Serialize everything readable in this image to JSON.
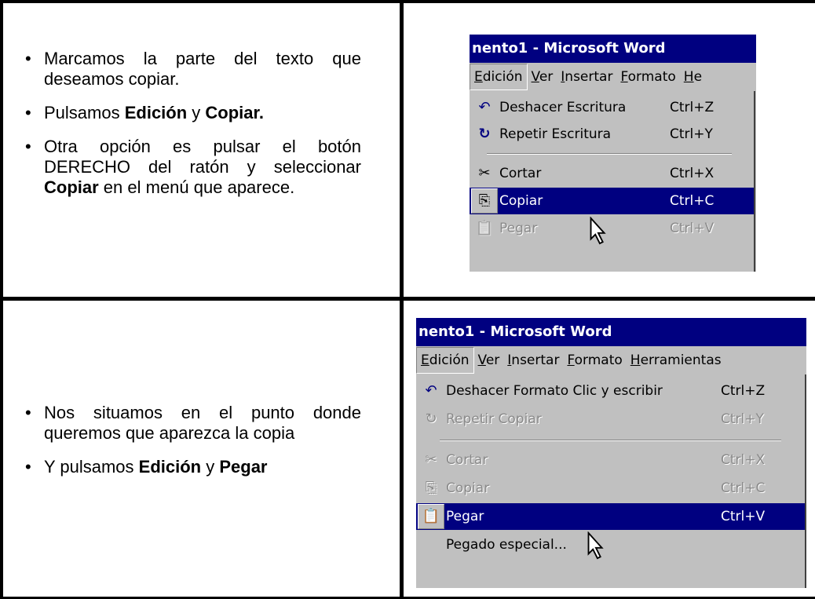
{
  "row1": {
    "bullets": [
      {
        "text": "Marcamos la parte del texto que deseamos copiar."
      },
      {
        "pre": "Pulsamos ",
        "b1": "Edición",
        "mid": " y ",
        "b2": "Copiar."
      },
      {
        "pre": "Otra opción es pulsar el botón DERECHO del ratón y seleccionar ",
        "b1": "Copiar",
        "post": " en el menú que aparece."
      }
    ],
    "screenshot": {
      "title": "nento1 - Microsoft Word",
      "menus": [
        "Edición",
        "Ver",
        "Insertar",
        "Formato",
        "He"
      ],
      "items": [
        {
          "icon": "↶",
          "label": "Deshacer Escritura",
          "shortcut": "Ctrl+Z"
        },
        {
          "icon": "↻",
          "label": "Repetir Escritura",
          "shortcut": "Ctrl+Y"
        },
        {
          "icon": "✂",
          "label": "Cortar",
          "shortcut": "Ctrl+X"
        },
        {
          "icon": "⎘",
          "label": "Copiar",
          "shortcut": "Ctrl+C"
        },
        {
          "icon": "📋",
          "label": "Pegar",
          "shortcut": "Ctrl+V"
        }
      ]
    }
  },
  "row2": {
    "bullets": [
      {
        "text": "Nos situamos en el punto donde queremos que aparezca la copia"
      },
      {
        "pre": "Y pulsamos ",
        "b1": "Edición",
        "mid": " y ",
        "b2": "Pegar"
      }
    ],
    "screenshot": {
      "title": "nento1 - Microsoft Word",
      "menus": [
        "Edición",
        "Ver",
        "Insertar",
        "Formato",
        "Herramientas"
      ],
      "items": [
        {
          "icon": "↶",
          "label": "Deshacer Formato Clic y escribir",
          "shortcut": "Ctrl+Z"
        },
        {
          "icon": "↻",
          "label": "Repetir Copiar",
          "shortcut": "Ctrl+Y"
        },
        {
          "icon": "✂",
          "label": "Cortar",
          "shortcut": "Ctrl+X"
        },
        {
          "icon": "⎘",
          "label": "Copiar",
          "shortcut": "Ctrl+C"
        },
        {
          "icon": "📋",
          "label": "Pegar",
          "shortcut": "Ctrl+V"
        },
        {
          "icon": "",
          "label": "Pegado especial...",
          "shortcut": ""
        }
      ]
    }
  }
}
